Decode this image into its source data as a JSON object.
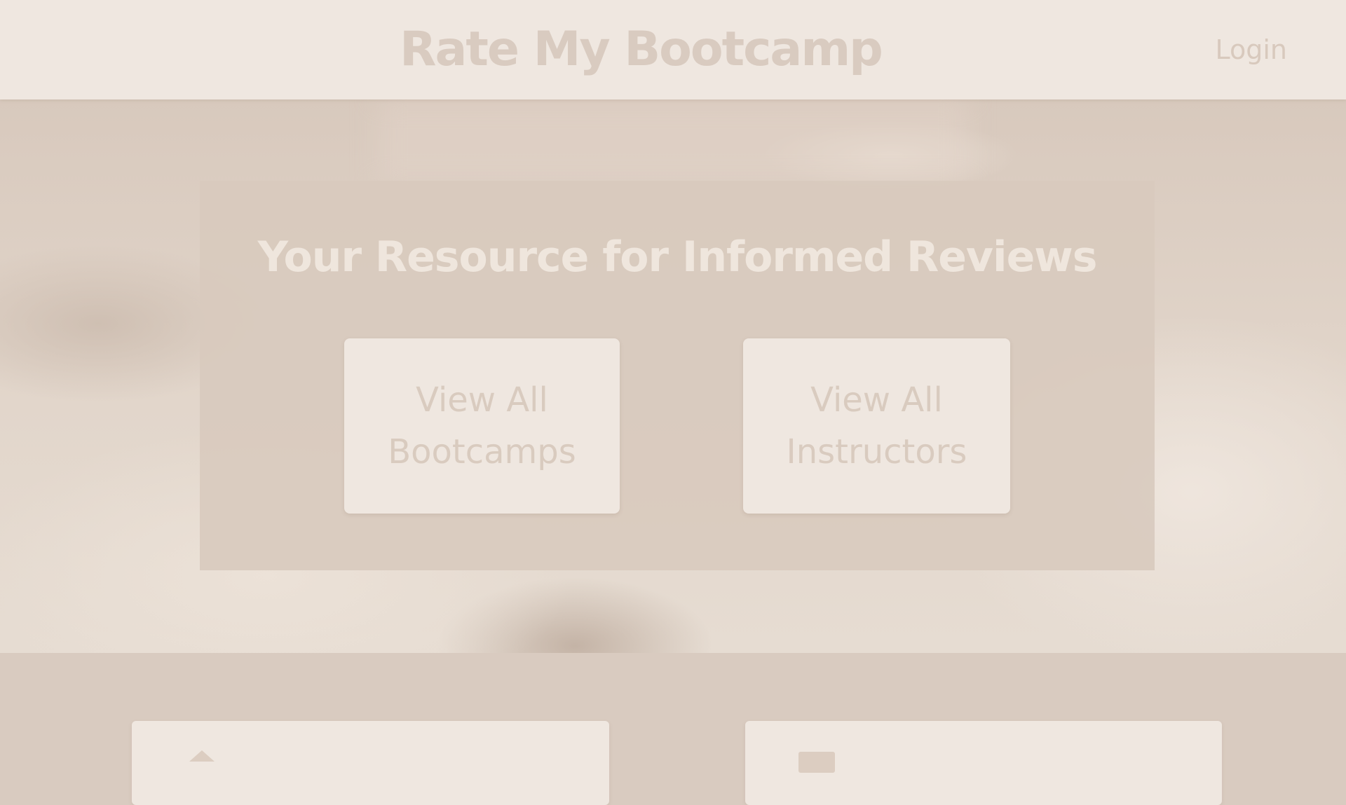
{
  "header": {
    "title": "Rate My Bootcamp",
    "login_label": "Login"
  },
  "hero": {
    "heading": "Your Resource for Informed Reviews",
    "buttons": [
      {
        "line1": "View All",
        "line2": "Bootcamps"
      },
      {
        "line1": "View All",
        "line2": "Instructors"
      }
    ]
  },
  "lower": {
    "cards": [
      {
        "icon": "home-icon"
      },
      {
        "icon": "document-icon"
      }
    ]
  },
  "colors": {
    "header_bg": "#efe7e0",
    "page_bg": "#d9cbc0",
    "card_bg": "#efe7e0",
    "title_text": "#d9cbc0",
    "hero_heading": "#efe6dd"
  }
}
